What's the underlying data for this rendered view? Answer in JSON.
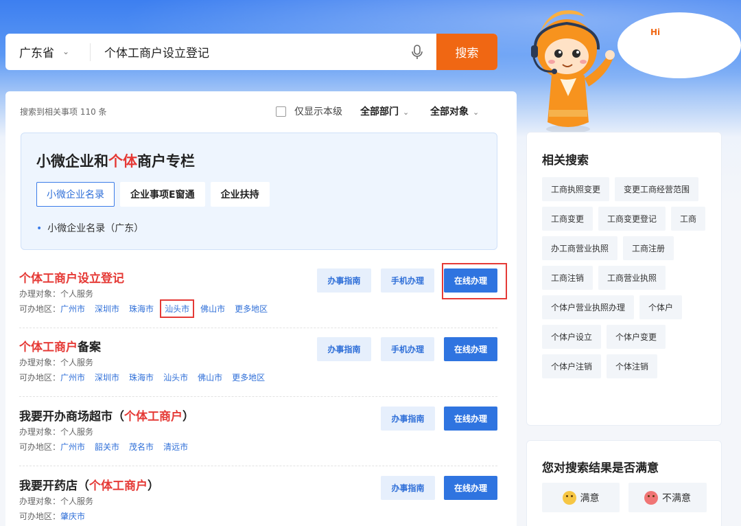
{
  "search": {
    "region": "广东省",
    "query": "个体工商户设立登记",
    "button": "搜索"
  },
  "mascot": {
    "greeting": "Hi"
  },
  "filters": {
    "result_count": "搜索到相关事项 110 条",
    "local_only": "仅显示本级",
    "department": "全部部门",
    "target": "全部对象"
  },
  "special": {
    "title_pre": "小微企业和",
    "title_hl": "个体",
    "title_post": "商户专栏",
    "tabs": [
      "小微企业名录",
      "企业事项E窗通",
      "企业扶持"
    ],
    "item": "小微企业名录（广东）"
  },
  "results": [
    {
      "title_hl": "个体工商户设立登记",
      "title_post": "",
      "meta": "办理对象：个人服务",
      "area_label": "可办地区：",
      "areas": [
        "广州市",
        "深圳市",
        "珠海市",
        "汕头市",
        "佛山市",
        "更多地区"
      ],
      "buttons": [
        "办事指南",
        "手机办理",
        "在线办理"
      ]
    },
    {
      "title_hl": "个体工商户",
      "title_post": "备案",
      "meta": "办理对象：个人服务",
      "area_label": "可办地区：",
      "areas": [
        "广州市",
        "深圳市",
        "珠海市",
        "汕头市",
        "佛山市",
        "更多地区"
      ],
      "buttons": [
        "办事指南",
        "手机办理",
        "在线办理"
      ]
    },
    {
      "title_pre": "我要开办商场超市（",
      "title_hl": "个体工商户",
      "title_post": "）",
      "meta": "办理对象：个人服务",
      "area_label": "可办地区：",
      "areas": [
        "广州市",
        "韶关市",
        "茂名市",
        "清远市"
      ],
      "buttons": [
        "办事指南",
        "在线办理"
      ]
    },
    {
      "title_pre": "我要开药店（",
      "title_hl": "个体工商户",
      "title_post": "）",
      "meta": "办理对象：个人服务",
      "area_label": "可办地区：",
      "areas": [
        "肇庆市"
      ],
      "buttons": [
        "办事指南",
        "在线办理"
      ]
    }
  ],
  "related": {
    "title": "相关搜索",
    "chips": [
      "工商执照变更",
      "变更工商经营范围",
      "工商变更",
      "工商变更登记",
      "工商",
      "办工商营业执照",
      "工商注册",
      "工商注销",
      "工商营业执照",
      "个体户营业执照办理",
      "个体户",
      "个体户设立",
      "个体户变更",
      "个体户注销",
      "个体注销"
    ]
  },
  "feedback": {
    "title": "您对搜索结果是否满意",
    "satisfied": "满意",
    "unsatisfied": "不满意"
  },
  "colors": {
    "accent": "#2f74e0",
    "search_button": "#f06713",
    "highlight": "#e53935"
  },
  "icons": [
    "chevron-down-icon",
    "microphone-icon",
    "smile-icon",
    "frown-icon"
  ]
}
